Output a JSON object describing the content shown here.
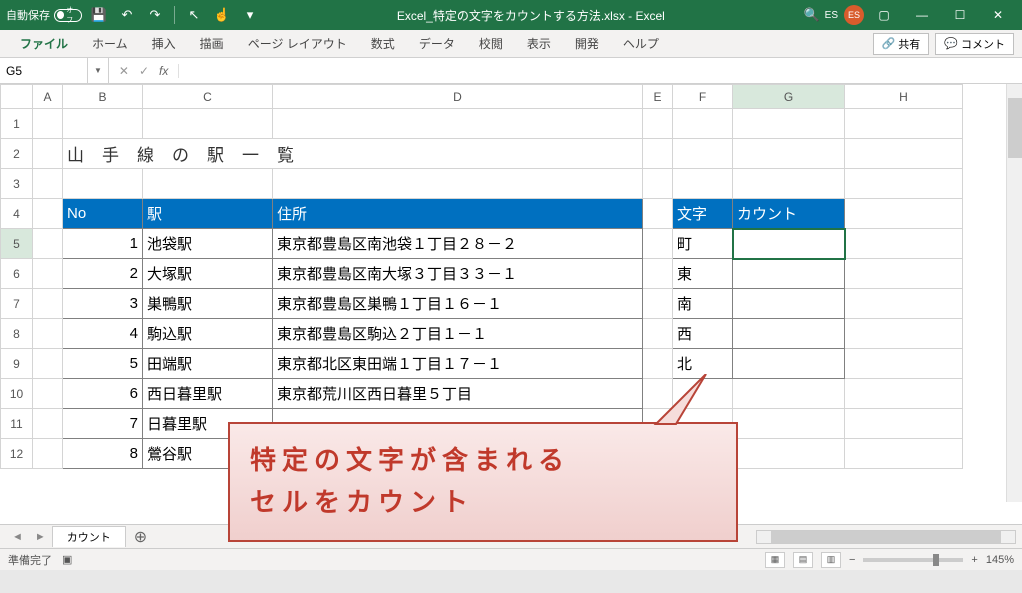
{
  "titlebar": {
    "autosave_label": "自動保存",
    "autosave_state": "オフ",
    "filename": "Excel_特定の文字をカウントする方法.xlsx - Excel",
    "user_initials_text": "ES",
    "user_badge": "ES"
  },
  "ribbon": {
    "tabs": [
      "ファイル",
      "ホーム",
      "挿入",
      "描画",
      "ページ レイアウト",
      "数式",
      "データ",
      "校閲",
      "表示",
      "開発",
      "ヘルプ"
    ],
    "share": "共有",
    "comment": "コメント"
  },
  "formula_bar": {
    "namebox": "G5",
    "formula": ""
  },
  "columns": [
    "A",
    "B",
    "C",
    "D",
    "E",
    "F",
    "G",
    "H"
  ],
  "rows": [
    "1",
    "2",
    "3",
    "4",
    "5",
    "6",
    "7",
    "8",
    "9",
    "10",
    "11",
    "12"
  ],
  "sheet": {
    "title": "山手線の駅一覧",
    "headers": {
      "no": "No",
      "station": "駅",
      "address": "住所"
    },
    "stations": [
      {
        "no": "1",
        "name": "池袋駅",
        "addr": "東京都豊島区南池袋１丁目２８－２"
      },
      {
        "no": "2",
        "name": "大塚駅",
        "addr": "東京都豊島区南大塚３丁目３３－１"
      },
      {
        "no": "3",
        "name": "巣鴨駅",
        "addr": "東京都豊島区巣鴨１丁目１６－１"
      },
      {
        "no": "4",
        "name": "駒込駅",
        "addr": "東京都豊島区駒込２丁目１－１"
      },
      {
        "no": "5",
        "name": "田端駅",
        "addr": "東京都北区東田端１丁目１７－１"
      },
      {
        "no": "6",
        "name": "西日暮里駅",
        "addr": "東京都荒川区西日暮里５丁目"
      },
      {
        "no": "7",
        "name": "日暮里駅",
        "addr": ""
      },
      {
        "no": "8",
        "name": "鶯谷駅",
        "addr": ""
      }
    ],
    "count_headers": {
      "char": "文字",
      "count": "カウント"
    },
    "count_rows": [
      "町",
      "東",
      "南",
      "西",
      "北"
    ]
  },
  "sheettab": {
    "name": "カウント"
  },
  "status": {
    "ready": "準備完了",
    "zoom": "145%"
  },
  "callout": {
    "line1": "特定の文字が含まれる",
    "line2": "セルをカウント"
  }
}
